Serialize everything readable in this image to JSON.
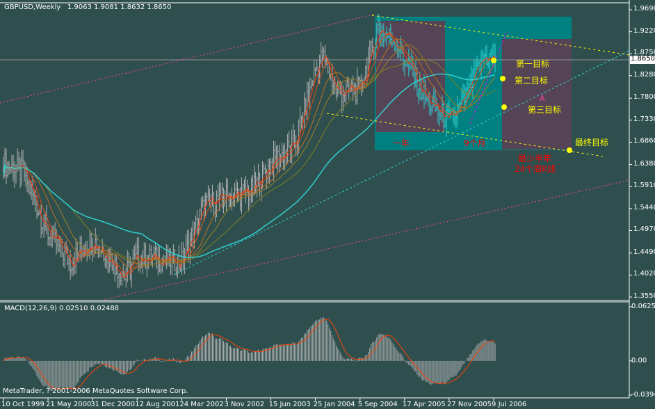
{
  "header": {
    "symbol_period": "GBPUSD,Weekly",
    "open": "1.9063",
    "high": "1.9081",
    "low": "1.8632",
    "close": "1.8650"
  },
  "macd_header": {
    "label": "MACD(12,26,9)",
    "main": "0.02510",
    "signal": "0.02488"
  },
  "copyright": "MetaTrader, ? 2001-2006 MetaQuotes Software Corp.",
  "current_price": "1.8650",
  "annotations": {
    "target1": "第一目标",
    "target2": "第二目标",
    "target3": "第三目标",
    "final_target": "最终目标",
    "one_year": "一年",
    "nine_months": "9个月",
    "min_half_year": "最少半年",
    "weekly_bars": "24个周K线",
    "wave_a": "A"
  },
  "colors": {
    "background": "#2f4f4f",
    "rect_teal": "#008080",
    "rect_purple": "#554455",
    "target_text": "#ffff00",
    "note_text": "#ff0000",
    "ma_fast": "#ff3000",
    "ma_long": "#30d0d0",
    "macd_hist": "#b0b0b0",
    "macd_signal": "#ff4000"
  },
  "chart_data": {
    "type": "ohlc",
    "title": "GBPUSD,Weekly",
    "x_tick_labels": [
      "10 Oct 1999",
      "21 May 2000",
      "31 Dec 2000",
      "12 Aug 2001",
      "24 Mar 2002",
      "3 Nov 2002",
      "15 Jun 2003",
      "25 Jan 2004",
      "5 Sep 2004",
      "17 Apr 2005",
      "27 Nov 2005",
      "9 Jul 2006"
    ],
    "y_tick_labels": [
      "1.9690",
      "1.9220",
      "1.8750",
      "1.8280",
      "1.7800",
      "1.7330",
      "1.6860",
      "1.6380",
      "1.5910",
      "1.5440",
      "1.4970",
      "1.4490",
      "1.4020",
      "1.3550"
    ],
    "ylim": [
      1.355,
      1.969
    ],
    "price_path": [
      [
        "1999-10-10",
        1.64
      ],
      [
        "2000-01-20",
        1.62
      ],
      [
        "2000-05-21",
        1.49
      ],
      [
        "2000-09-10",
        1.43
      ],
      [
        "2000-12-31",
        1.48
      ],
      [
        "2001-06-10",
        1.4
      ],
      [
        "2001-08-12",
        1.44
      ],
      [
        "2002-03-24",
        1.43
      ],
      [
        "2002-07-14",
        1.55
      ],
      [
        "2002-11-03",
        1.57
      ],
      [
        "2003-03-09",
        1.58
      ],
      [
        "2003-06-15",
        1.64
      ],
      [
        "2003-10-12",
        1.68
      ],
      [
        "2004-01-25",
        1.84
      ],
      [
        "2004-02-29",
        1.87
      ],
      [
        "2004-05-16",
        1.79
      ],
      [
        "2004-09-05",
        1.8
      ],
      [
        "2004-12-05",
        1.93
      ],
      [
        "2005-03-06",
        1.9
      ],
      [
        "2005-05-15",
        1.84
      ],
      [
        "2005-08-14",
        1.77
      ],
      [
        "2005-11-27",
        1.73
      ],
      [
        "2006-01-22",
        1.76
      ],
      [
        "2006-05-21",
        1.87
      ],
      [
        "2006-07-16",
        1.865
      ]
    ],
    "moving_averages": [
      5,
      10,
      20,
      30,
      50,
      100
    ],
    "macd": {
      "fast": 12,
      "slow": 26,
      "signal": 9,
      "ylim": [
        -0.03945,
        0.06259
      ],
      "y_tick_labels": [
        "0.06259",
        "0.00",
        "-0.03945"
      ]
    }
  }
}
